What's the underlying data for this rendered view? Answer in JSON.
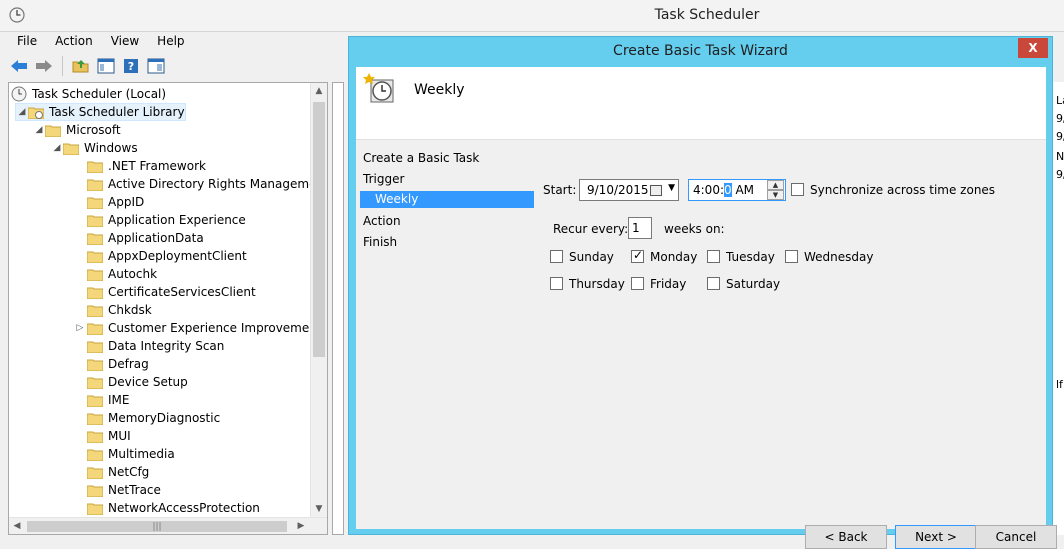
{
  "main_window": {
    "title": "Task Scheduler",
    "menu": [
      "File",
      "Action",
      "View",
      "Help"
    ]
  },
  "tree": {
    "items": [
      {
        "label": "Task Scheduler (Local)"
      },
      {
        "label": "Task Scheduler Library"
      },
      {
        "label": "Microsoft"
      },
      {
        "label": "Windows"
      },
      {
        "label": ".NET Framework"
      },
      {
        "label": "Active Directory Rights Management S"
      },
      {
        "label": "AppID"
      },
      {
        "label": "Application Experience"
      },
      {
        "label": "ApplicationData"
      },
      {
        "label": "AppxDeploymentClient"
      },
      {
        "label": "Autochk"
      },
      {
        "label": "CertificateServicesClient"
      },
      {
        "label": "Chkdsk"
      },
      {
        "label": "Customer Experience Improvement Pr"
      },
      {
        "label": "Data Integrity Scan"
      },
      {
        "label": "Defrag"
      },
      {
        "label": "Device Setup"
      },
      {
        "label": "IME"
      },
      {
        "label": "MemoryDiagnostic"
      },
      {
        "label": "MUI"
      },
      {
        "label": "Multimedia"
      },
      {
        "label": "NetCfg"
      },
      {
        "label": "NetTrace"
      },
      {
        "label": "NetworkAccessProtection"
      }
    ]
  },
  "wizard": {
    "title": "Create Basic Task Wizard",
    "close": "X",
    "heading": "Weekly",
    "steps": [
      "Create a Basic Task",
      "Trigger",
      "Weekly",
      "Action",
      "Finish"
    ],
    "start_label": "Start:",
    "start_date": "9/10/2015",
    "start_time_prefix": "4:00:",
    "start_time_hl": "0",
    "start_time_suffix": "AM",
    "sync_label": "Synchronize across time zones",
    "recur_label": "Recur every:",
    "recur_value": "1",
    "weeks_on_label": "weeks on:",
    "days": [
      {
        "label": "Sunday",
        "checked": false
      },
      {
        "label": "Monday",
        "checked": true
      },
      {
        "label": "Tuesday",
        "checked": false
      },
      {
        "label": "Wednesday",
        "checked": false
      },
      {
        "label": "Thursday",
        "checked": false
      },
      {
        "label": "Friday",
        "checked": false
      },
      {
        "label": "Saturday",
        "checked": false
      }
    ],
    "back_label": "< Back",
    "next_label": "Next >",
    "cancel_label": "Cancel"
  },
  "right_edge_fragments": [
    "La",
    "9/",
    "9/",
    "N",
    "9/",
    "lf"
  ],
  "colors": {
    "wizard_frame": "#65cdee",
    "selection": "#3399ff",
    "close_button": "#c94839"
  }
}
